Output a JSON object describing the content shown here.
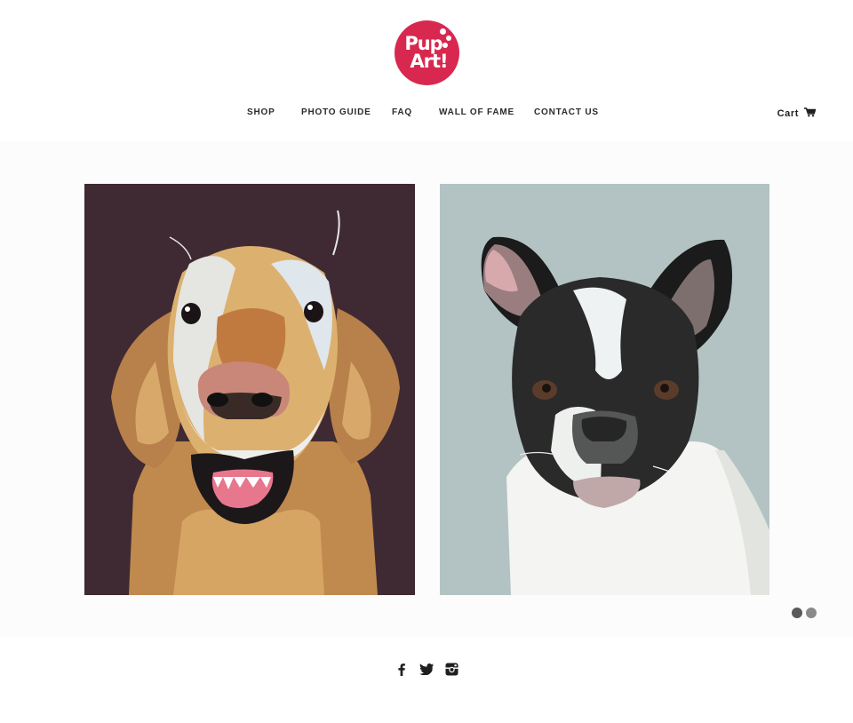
{
  "brand": {
    "line1": "Pup",
    "line2": "Art!",
    "color": "#d8284f"
  },
  "nav": {
    "items": [
      {
        "label": "SHOP"
      },
      {
        "label": "PHOTO GUIDE"
      },
      {
        "label": "FAQ"
      },
      {
        "label": "WALL OF FAME"
      },
      {
        "label": "CONTACT US"
      }
    ]
  },
  "cart": {
    "label": "Cart",
    "icon": "cart-icon"
  },
  "slider": {
    "slides": [
      {
        "subject": "golden retriever portrait",
        "background": "#3f2a33"
      },
      {
        "subject": "french bulldog portrait",
        "background": "#b3c3c3"
      }
    ],
    "pagination": {
      "count": 2,
      "active_index": 0,
      "active_color": "#5a5a5a",
      "inactive_color": "#8a8a8a"
    }
  },
  "social": {
    "icons": [
      "facebook-icon",
      "twitter-icon",
      "instagram-icon"
    ]
  }
}
